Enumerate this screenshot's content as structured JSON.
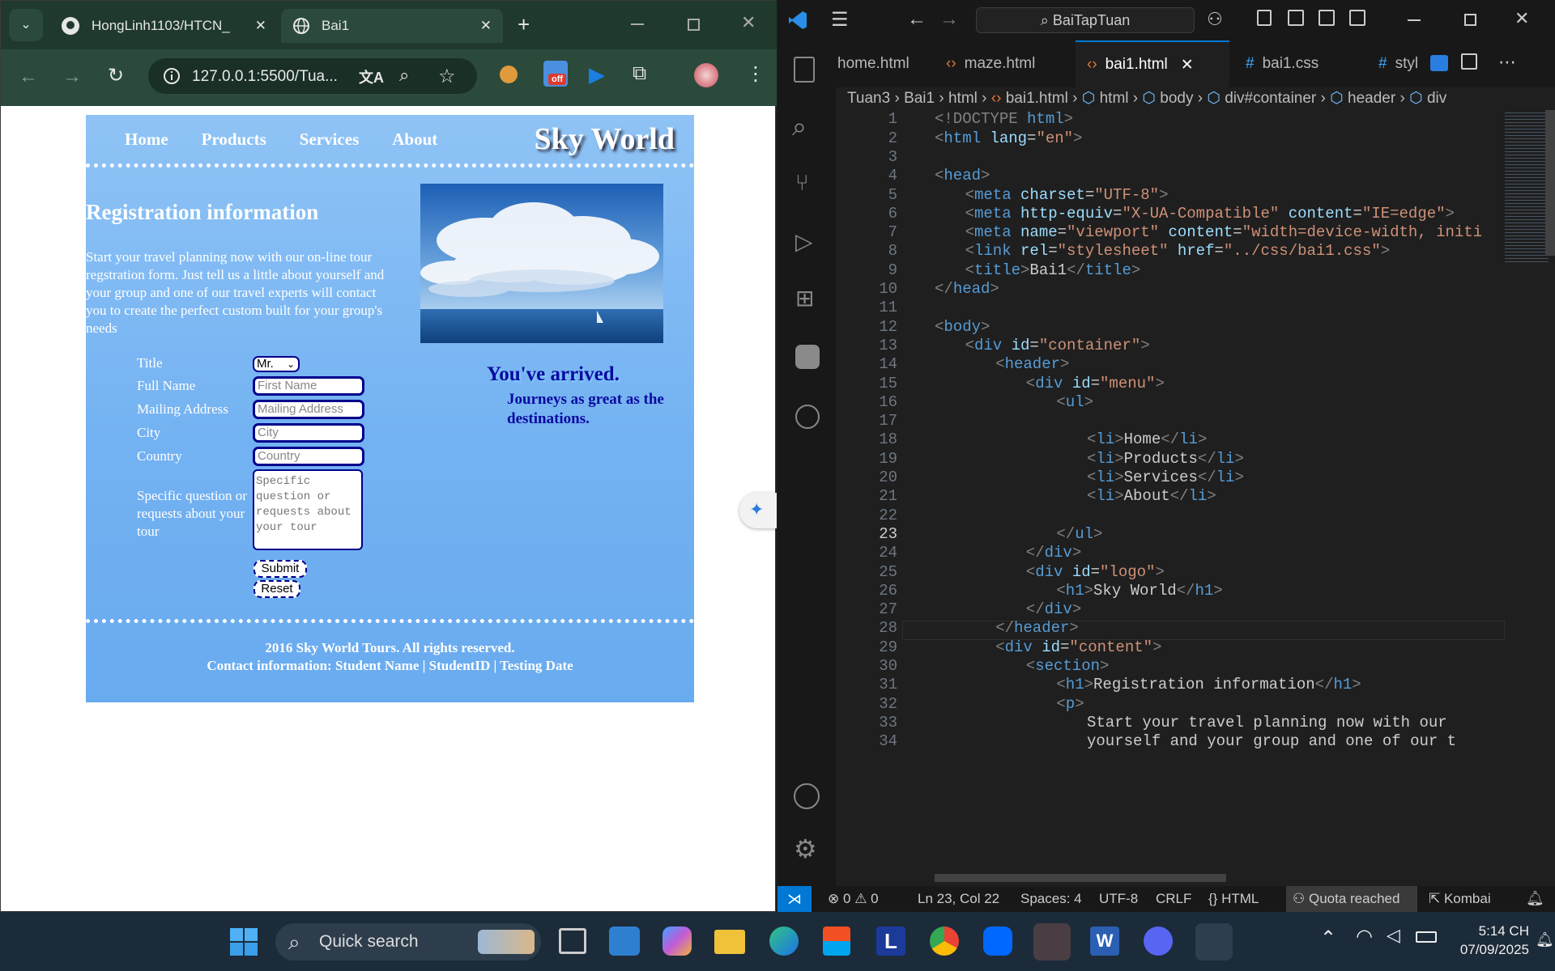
{
  "browser": {
    "tabs": [
      {
        "title": "HongLinh1103/HTCN_"
      },
      {
        "title": "Bai1"
      }
    ],
    "url": "127.0.0.1:5500/Tua...",
    "extension_badge": "off"
  },
  "site": {
    "nav": [
      "Home",
      "Products",
      "Services",
      "About"
    ],
    "logo": "Sky World",
    "heading": "Registration information",
    "intro": "Start your travel planning now with our on-line tour regstration form. Just tell us a little about yourself and your group and one of our travel experts will contact you to create the perfect custom built for your group's needs",
    "form": {
      "title_label": "Title",
      "title_value": "Mr.",
      "fullname_label": "Full Name",
      "fullname_placeholder": "First Name",
      "address_label": "Mailing Address",
      "address_placeholder": "Mailing Address",
      "city_label": "City",
      "city_placeholder": "City",
      "country_label": "Country",
      "country_placeholder": "Country",
      "question_label": "Specific question or requests about your tour",
      "question_placeholder": "Specific question or requests about your tour",
      "submit": "Submit",
      "reset": "Reset"
    },
    "arrived": "You've arrived.",
    "journeys": "Journeys as great as the destinations.",
    "footer1": "2016 Sky World Tours. All rights reserved.",
    "footer2": "Contact information: Student Name | StudentID | Testing Date"
  },
  "vscode": {
    "search": "BaiTapTuan",
    "tabs": [
      "home.html",
      "maze.html",
      "bai1.html",
      "bai1.css",
      "styl"
    ],
    "breadcrumb": [
      "Tuan3",
      "Bai1",
      "html",
      "bai1.html",
      "html",
      "body",
      "div#container",
      "header",
      "div"
    ],
    "status": {
      "errors": "0",
      "warnings": "0",
      "position": "Ln 23, Col 22",
      "spaces": "Spaces: 4",
      "encoding": "UTF-8",
      "eol": "CRLF",
      "language": "HTML",
      "quota": "Quota reached",
      "kombai": "Kombai"
    }
  },
  "code_lines": [
    {
      "n": "1",
      "i": 0,
      "t": [
        [
          "tg",
          "<!DOCTYPE "
        ],
        [
          "tn",
          "html"
        ],
        [
          "tg",
          ">"
        ]
      ]
    },
    {
      "n": "2",
      "i": 0,
      "t": [
        [
          "tg",
          "<"
        ],
        [
          "tn",
          "html "
        ],
        [
          "at",
          "lang"
        ],
        [
          "tx",
          "="
        ],
        [
          "sv",
          "\"en\""
        ],
        [
          "tg",
          ">"
        ]
      ]
    },
    {
      "n": "3",
      "i": 0,
      "t": []
    },
    {
      "n": "4",
      "i": 0,
      "t": [
        [
          "tg",
          "<"
        ],
        [
          "tn",
          "head"
        ],
        [
          "tg",
          ">"
        ]
      ]
    },
    {
      "n": "5",
      "i": 1,
      "t": [
        [
          "tg",
          "<"
        ],
        [
          "tn",
          "meta "
        ],
        [
          "at",
          "charset"
        ],
        [
          "tx",
          "="
        ],
        [
          "sv",
          "\"UTF-8\""
        ],
        [
          "tg",
          ">"
        ]
      ]
    },
    {
      "n": "6",
      "i": 1,
      "t": [
        [
          "tg",
          "<"
        ],
        [
          "tn",
          "meta "
        ],
        [
          "at",
          "http-equiv"
        ],
        [
          "tx",
          "="
        ],
        [
          "sv",
          "\"X-UA-Compatible\" "
        ],
        [
          "at",
          "content"
        ],
        [
          "tx",
          "="
        ],
        [
          "sv",
          "\"IE=edge\""
        ],
        [
          "tg",
          ">"
        ]
      ]
    },
    {
      "n": "7",
      "i": 1,
      "t": [
        [
          "tg",
          "<"
        ],
        [
          "tn",
          "meta "
        ],
        [
          "at",
          "name"
        ],
        [
          "tx",
          "="
        ],
        [
          "sv",
          "\"viewport\" "
        ],
        [
          "at",
          "content"
        ],
        [
          "tx",
          "="
        ],
        [
          "sv",
          "\"width=device-width, initi"
        ]
      ]
    },
    {
      "n": "8",
      "i": 1,
      "t": [
        [
          "tg",
          "<"
        ],
        [
          "tn",
          "link "
        ],
        [
          "at",
          "rel"
        ],
        [
          "tx",
          "="
        ],
        [
          "sv",
          "\"stylesheet\" "
        ],
        [
          "at",
          "href"
        ],
        [
          "tx",
          "="
        ],
        [
          "sv",
          "\"../css/bai1.css\""
        ],
        [
          "tg",
          ">"
        ]
      ]
    },
    {
      "n": "9",
      "i": 1,
      "t": [
        [
          "tg",
          "<"
        ],
        [
          "tn",
          "title"
        ],
        [
          "tg",
          ">"
        ],
        [
          "tx",
          "Bai1"
        ],
        [
          "tg",
          "</"
        ],
        [
          "tn",
          "title"
        ],
        [
          "tg",
          ">"
        ]
      ]
    },
    {
      "n": "10",
      "i": 0,
      "t": [
        [
          "tg",
          "</"
        ],
        [
          "tn",
          "head"
        ],
        [
          "tg",
          ">"
        ]
      ]
    },
    {
      "n": "11",
      "i": 0,
      "t": []
    },
    {
      "n": "12",
      "i": 0,
      "t": [
        [
          "tg",
          "<"
        ],
        [
          "tn",
          "body"
        ],
        [
          "tg",
          ">"
        ]
      ]
    },
    {
      "n": "13",
      "i": 1,
      "t": [
        [
          "tg",
          "<"
        ],
        [
          "tn",
          "div "
        ],
        [
          "at",
          "id"
        ],
        [
          "tx",
          "="
        ],
        [
          "sv",
          "\"container\""
        ],
        [
          "tg",
          ">"
        ]
      ]
    },
    {
      "n": "14",
      "i": 2,
      "t": [
        [
          "tg",
          "<"
        ],
        [
          "tn",
          "header"
        ],
        [
          "tg",
          ">"
        ]
      ]
    },
    {
      "n": "15",
      "i": 3,
      "t": [
        [
          "tg",
          "<"
        ],
        [
          "tn",
          "div "
        ],
        [
          "at",
          "id"
        ],
        [
          "tx",
          "="
        ],
        [
          "sv",
          "\"menu\""
        ],
        [
          "tg",
          ">"
        ]
      ]
    },
    {
      "n": "16",
      "i": 4,
      "t": [
        [
          "tg",
          "<"
        ],
        [
          "tn",
          "ul"
        ],
        [
          "tg",
          ">"
        ]
      ]
    },
    {
      "n": "17",
      "i": 0,
      "t": []
    },
    {
      "n": "18",
      "i": 5,
      "t": [
        [
          "tg",
          "<"
        ],
        [
          "tn",
          "li"
        ],
        [
          "tg",
          ">"
        ],
        [
          "tx",
          "Home"
        ],
        [
          "tg",
          "</"
        ],
        [
          "tn",
          "li"
        ],
        [
          "tg",
          ">"
        ]
      ]
    },
    {
      "n": "19",
      "i": 5,
      "t": [
        [
          "tg",
          "<"
        ],
        [
          "tn",
          "li"
        ],
        [
          "tg",
          ">"
        ],
        [
          "tx",
          "Products"
        ],
        [
          "tg",
          "</"
        ],
        [
          "tn",
          "li"
        ],
        [
          "tg",
          ">"
        ]
      ]
    },
    {
      "n": "20",
      "i": 5,
      "t": [
        [
          "tg",
          "<"
        ],
        [
          "tn",
          "li"
        ],
        [
          "tg",
          ">"
        ],
        [
          "tx",
          "Services"
        ],
        [
          "tg",
          "</"
        ],
        [
          "tn",
          "li"
        ],
        [
          "tg",
          ">"
        ]
      ]
    },
    {
      "n": "21",
      "i": 5,
      "t": [
        [
          "tg",
          "<"
        ],
        [
          "tn",
          "li"
        ],
        [
          "tg",
          ">"
        ],
        [
          "tx",
          "About"
        ],
        [
          "tg",
          "</"
        ],
        [
          "tn",
          "li"
        ],
        [
          "tg",
          ">"
        ]
      ]
    },
    {
      "n": "22",
      "i": 0,
      "t": []
    },
    {
      "n": "23",
      "i": 4,
      "t": [
        [
          "tg",
          "</"
        ],
        [
          "tn",
          "ul"
        ],
        [
          "tg",
          ">"
        ]
      ]
    },
    {
      "n": "24",
      "i": 3,
      "t": [
        [
          "tg",
          "</"
        ],
        [
          "tn",
          "div"
        ],
        [
          "tg",
          ">"
        ]
      ]
    },
    {
      "n": "25",
      "i": 3,
      "t": [
        [
          "tg",
          "<"
        ],
        [
          "tn",
          "div "
        ],
        [
          "at",
          "id"
        ],
        [
          "tx",
          "="
        ],
        [
          "sv",
          "\"logo\""
        ],
        [
          "tg",
          ">"
        ]
      ]
    },
    {
      "n": "26",
      "i": 4,
      "t": [
        [
          "tg",
          "<"
        ],
        [
          "tn",
          "h1"
        ],
        [
          "tg",
          ">"
        ],
        [
          "tx",
          "Sky World"
        ],
        [
          "tg",
          "</"
        ],
        [
          "tn",
          "h1"
        ],
        [
          "tg",
          ">"
        ]
      ]
    },
    {
      "n": "27",
      "i": 3,
      "t": [
        [
          "tg",
          "</"
        ],
        [
          "tn",
          "div"
        ],
        [
          "tg",
          ">"
        ]
      ]
    },
    {
      "n": "28",
      "i": 2,
      "t": [
        [
          "tg",
          "</"
        ],
        [
          "tn",
          "header"
        ],
        [
          "tg",
          ">"
        ]
      ]
    },
    {
      "n": "29",
      "i": 2,
      "t": [
        [
          "tg",
          "<"
        ],
        [
          "tn",
          "div "
        ],
        [
          "at",
          "id"
        ],
        [
          "tx",
          "="
        ],
        [
          "sv",
          "\"content\""
        ],
        [
          "tg",
          ">"
        ]
      ]
    },
    {
      "n": "30",
      "i": 3,
      "t": [
        [
          "tg",
          "<"
        ],
        [
          "tn",
          "section"
        ],
        [
          "tg",
          ">"
        ]
      ]
    },
    {
      "n": "31",
      "i": 4,
      "t": [
        [
          "tg",
          "<"
        ],
        [
          "tn",
          "h1"
        ],
        [
          "tg",
          ">"
        ],
        [
          "tx",
          "Registration information"
        ],
        [
          "tg",
          "</"
        ],
        [
          "tn",
          "h1"
        ],
        [
          "tg",
          ">"
        ]
      ]
    },
    {
      "n": "32",
      "i": 4,
      "t": [
        [
          "tg",
          "<"
        ],
        [
          "tn",
          "p"
        ],
        [
          "tg",
          ">"
        ]
      ]
    },
    {
      "n": "33",
      "i": 5,
      "t": [
        [
          "tx",
          "Start your travel planning now with our"
        ]
      ]
    },
    {
      "n": "34",
      "i": 5,
      "t": [
        [
          "tx",
          "yourself and your group and one of our t"
        ]
      ]
    }
  ],
  "taskbar": {
    "search_placeholder": "Quick search",
    "time": "5:14 CH",
    "date": "07/09/2025"
  }
}
